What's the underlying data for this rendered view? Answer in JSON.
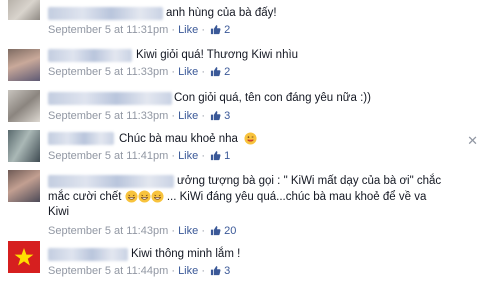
{
  "comments": [
    {
      "text": "anh hùng của bà đấy!",
      "time": "September 5 at 11:31pm",
      "like": "Like",
      "count": "2"
    },
    {
      "text": "Kiwi giỏi quá! Thương Kiwi nhìu",
      "time": "September 5 at 11:33pm",
      "like": "Like",
      "count": "2"
    },
    {
      "text": "Con giỏi quá, tên con đáng yêu nữa :))",
      "time": "September 5 at 11:33pm",
      "like": "Like",
      "count": "3"
    },
    {
      "text": "Chúc bà mau khoẻ nha",
      "time": "September 5 at 11:41pm",
      "like": "Like",
      "count": "1"
    },
    {
      "line1": "ưởng tượng bà gọi : \" KiWi mất dạy của bà ơi\" chắc",
      "line2a": "mắc cười chết",
      "line2b": "... KiWi đáng yêu quá...chúc bà mau khoẻ để về va",
      "line3": "Kiwi",
      "time": "September 5 at 11:43pm",
      "like": "Like",
      "count": "20"
    },
    {
      "text": "Kiwi thông minh lắm !",
      "time": "September 5 at 11:44pm",
      "like": "Like",
      "count": "3"
    }
  ],
  "separator": "·",
  "icons": {
    "like": "thumbs-up-icon",
    "close": "close-icon",
    "emoji": "grin-emoji-icon"
  },
  "colors": {
    "link": "#3b5998",
    "meta": "#9197a3",
    "text": "#141823"
  }
}
